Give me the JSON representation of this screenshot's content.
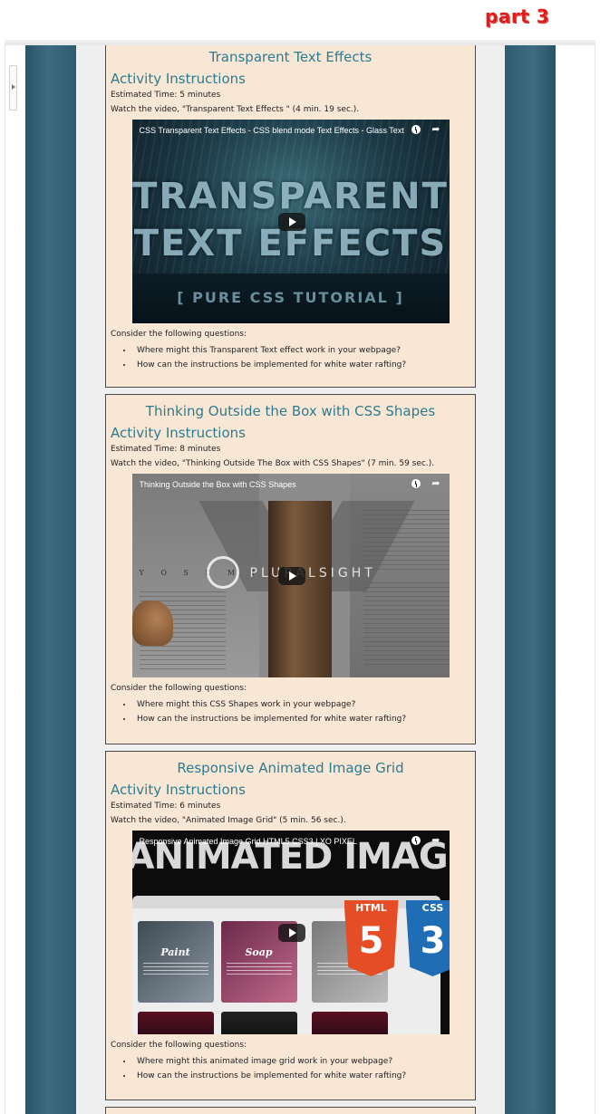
{
  "corner_label": "part 3",
  "cards": [
    {
      "title": "Transparent Text Effects",
      "heading": "Activity Instructions",
      "time": "Estimated Time: 5 minutes",
      "video_line": "Watch the video, \"Transparent Text Effects \" (4 min. 19 sec.).",
      "video": {
        "title": "CSS Transparent Text Effects - CSS blend mode Text Effects - Glass Text ...",
        "art_line1": "TRANSPARENT",
        "art_line2": "TEXT EFFECTS",
        "art_line3": "[ PURE CSS TUTORIAL ]"
      },
      "consider": "Consider the following questions:",
      "questions": [
        "Where might this Transparent Text effect work in your webpage?",
        "How can the instructions be implemented for white water rafting?"
      ]
    },
    {
      "title": "Thinking Outside the Box with CSS Shapes",
      "heading": "Activity Instructions",
      "time": "Estimated Time: 8 minutes",
      "video_line": "Watch the video, \"Thinking Outside The Box with CSS Shapes\" (7 min. 59 sec.).",
      "video": {
        "title": "Thinking Outside the Box with CSS Shapes",
        "art_line1": "Y O S E M I",
        "art_line2": "PLURALSIGHT"
      },
      "consider": "Consider the following questions:",
      "questions": [
        "Where might this CSS Shapes  work in your webpage?",
        "How can the instructions be implemented for white water rafting?"
      ]
    },
    {
      "title": "Responsive Animated Image Grid",
      "heading": "Activity Instructions",
      "time": "Estimated Time: 6 minutes",
      "video_line": "Watch the video, \"Animated Image Grid\" (5 min. 56 sec.).",
      "video": {
        "title": "Responsive Animated Image Grid HTML5 CSS3 | XO PIXEL",
        "art_header": "ANIMATED IMAGE GRID",
        "tile1": "Paint",
        "tile2": "Soap",
        "html_tag": "HTML",
        "html_num": "5",
        "css_tag": "CSS",
        "css_num": "3"
      },
      "consider": "Consider the following questions:",
      "questions": [
        "Where might this animated image grid work in your webpage?",
        "How can the instructions be implemented for white water rafting?"
      ]
    }
  ],
  "icons": {
    "watch_later": "clock-icon",
    "share": "share-icon",
    "play": "play-icon"
  },
  "colors": {
    "heading": "#2e7b90",
    "card_bg": "#f8e7d5",
    "side_panel": "#3d6c80",
    "part_label": "#e21b1b"
  }
}
